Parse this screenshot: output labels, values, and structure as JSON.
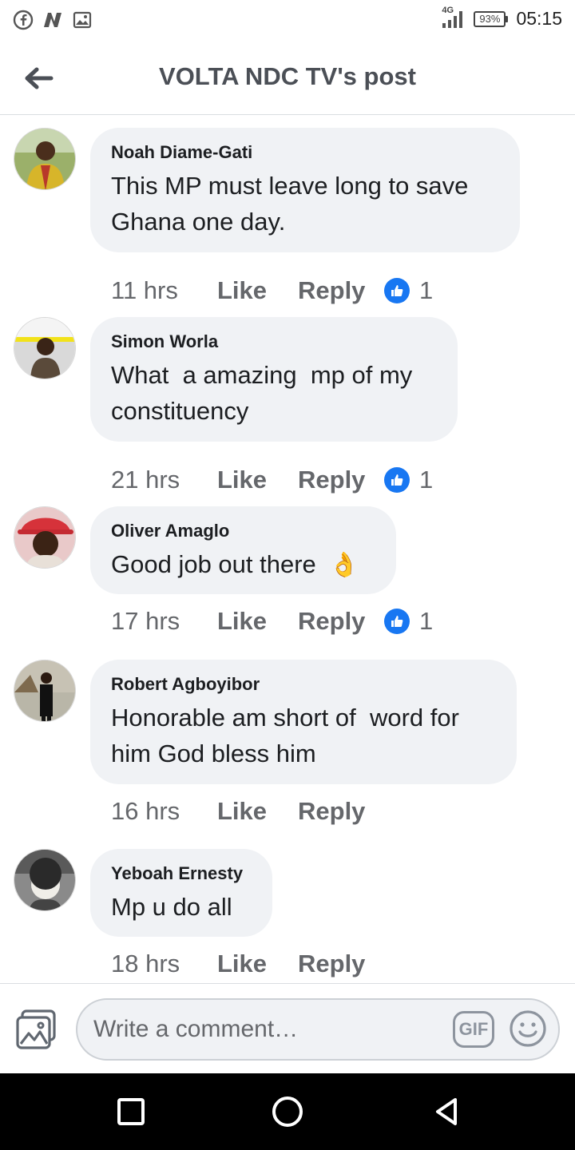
{
  "status_bar": {
    "left_icons": [
      "facebook-icon",
      "n-app-icon",
      "image-icon"
    ],
    "network": "4G",
    "battery": "93%",
    "time": "05:15"
  },
  "header": {
    "back_icon": "arrow-left-icon",
    "title": "VOLTA NDC TV's post"
  },
  "comments": [
    {
      "author": "Noah Diame-Gati",
      "text": "This MP must leave long to save Ghana one day.",
      "time": "11 hrs",
      "like": "Like",
      "reply": "Reply",
      "reactions": "1"
    },
    {
      "author": "Simon Worla",
      "text": "What  a amazing  mp of my constituency",
      "time": "21 hrs",
      "like": "Like",
      "reply": "Reply",
      "reactions": "1"
    },
    {
      "author": "Oliver Amaglo",
      "text": "Good job out there",
      "emoji": "👌",
      "time": "17 hrs",
      "like": "Like",
      "reply": "Reply",
      "reactions": "1"
    },
    {
      "author": "Robert Agboyibor",
      "text": "Honorable am short of  word for him God bless him",
      "time": "16 hrs",
      "like": "Like",
      "reply": "Reply"
    },
    {
      "author": "Yeboah Ernesty",
      "text": "Mp u do all",
      "time": "18 hrs",
      "like": "Like",
      "reply": "Reply"
    }
  ],
  "composer": {
    "placeholder": "Write a comment…",
    "gif_label": "GIF",
    "photo_icon": "photo-icon",
    "emoji_icon": "smiley-icon"
  },
  "colors": {
    "bubble": "#f0f2f5",
    "like_blue": "#1877f2",
    "secondary_text": "#65676b"
  }
}
